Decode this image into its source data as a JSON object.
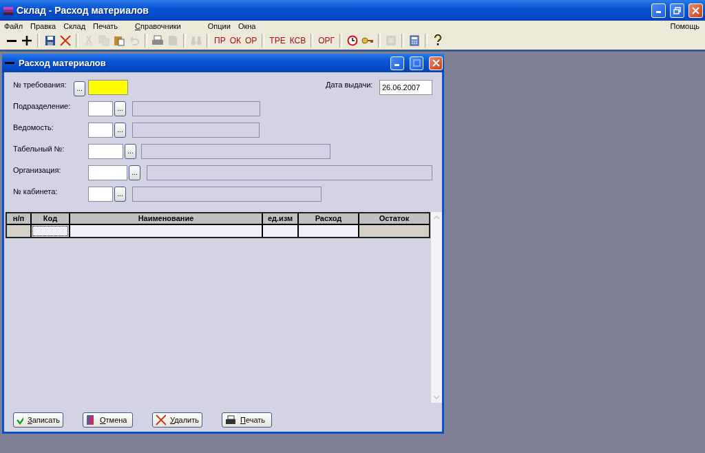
{
  "window": {
    "title": "Склад - Расход материалов"
  },
  "menu": [
    {
      "label": "Файл",
      "mnemonic": false
    },
    {
      "label": "Правка",
      "mnemonic": false
    },
    {
      "label": "Склад",
      "mnemonic": false
    },
    {
      "label": "Печать",
      "mnemonic": false
    },
    {
      "label": "Справочники",
      "mnemonic": true
    },
    {
      "label": "Опции",
      "mnemonic": false
    },
    {
      "label": "Окна",
      "mnemonic": false
    }
  ],
  "menu_right": "Помощь",
  "toolbar": [
    {
      "kind": "icon",
      "disabled": false
    },
    {
      "kind": "icon",
      "disabled": false
    },
    {
      "kind": "separator"
    },
    {
      "kind": "icon",
      "disabled": false
    },
    {
      "kind": "icon",
      "disabled": false
    },
    {
      "kind": "separator"
    },
    {
      "kind": "icon",
      "disabled": true
    },
    {
      "kind": "icon",
      "disabled": true
    },
    {
      "kind": "icon",
      "disabled": false
    },
    {
      "kind": "icon",
      "disabled": true
    },
    {
      "kind": "separator"
    },
    {
      "kind": "icon",
      "disabled": false
    },
    {
      "kind": "icon",
      "disabled": true
    },
    {
      "kind": "separator"
    },
    {
      "kind": "icon",
      "disabled": true
    },
    {
      "kind": "separator"
    },
    {
      "kind": "text",
      "label": "ПР"
    },
    {
      "kind": "text",
      "label": "ОК"
    },
    {
      "kind": "text",
      "label": "ОР"
    },
    {
      "kind": "separator"
    },
    {
      "kind": "text",
      "label": "ТРЕ"
    },
    {
      "kind": "text",
      "label": "КСВ"
    },
    {
      "kind": "separator"
    },
    {
      "kind": "text",
      "label": "ОРГ"
    },
    {
      "kind": "separator"
    },
    {
      "kind": "icon",
      "disabled": false
    },
    {
      "kind": "icon",
      "disabled": false
    },
    {
      "kind": "separator"
    },
    {
      "kind": "icon",
      "disabled": true
    },
    {
      "kind": "separator"
    },
    {
      "kind": "icon",
      "disabled": false
    },
    {
      "kind": "separator"
    },
    {
      "kind": "icon",
      "disabled": false
    }
  ],
  "child_window": {
    "title": "Расход материалов",
    "fields": [
      {
        "kind": "button_first",
        "label": "№ требования:",
        "button": "...",
        "focused": true
      },
      {
        "kind": "code_first",
        "label": "Подразделение:",
        "button": "..."
      },
      {
        "kind": "code_first",
        "label": "Ведомость:",
        "button": "..."
      },
      {
        "kind": "code_first",
        "label": "Табельный №:",
        "button": "..."
      },
      {
        "kind": "code_first",
        "label": "Организация:",
        "button": "..."
      },
      {
        "kind": "code_first",
        "label": "№ кабинета:",
        "button": "..."
      }
    ],
    "date": {
      "label": "Дата выдачи:",
      "value": "26.06.2007"
    },
    "table": {
      "columns": [
        "н/п",
        "Код",
        "Наименование",
        "ед.изм",
        "Расход",
        "Остаток"
      ]
    },
    "buttons": [
      {
        "label": "Записать"
      },
      {
        "label": "Отмена"
      },
      {
        "label": "Удалить"
      },
      {
        "label": "Печать"
      }
    ]
  }
}
